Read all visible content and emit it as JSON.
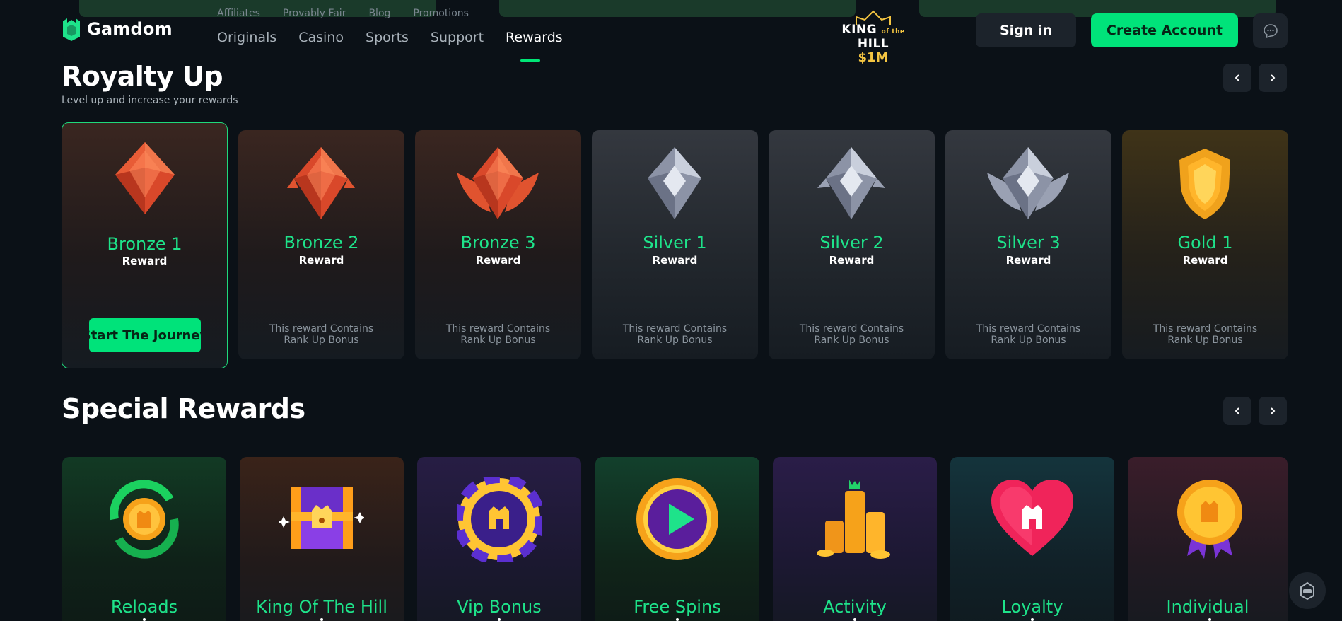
{
  "header": {
    "logo_text": "Gamdom",
    "sub_nav": [
      "Affiliates",
      "Provably Fair",
      "Blog",
      "Promotions"
    ],
    "main_nav": [
      "Originals",
      "Casino",
      "Sports",
      "Support",
      "Rewards"
    ],
    "active_nav": "Rewards",
    "promo": {
      "title_left": "KING",
      "title_small": "of the",
      "title_right": "HILL",
      "amount": "$1M"
    },
    "signin_label": "Sign in",
    "create_label": "Create Account",
    "chat_icon": "chat-bubble-icon"
  },
  "royalty": {
    "title": "Royalty Up",
    "subtitle": "Level up and increase your rewards",
    "ranks": [
      {
        "name": "Bronze 1",
        "reward": "Reward",
        "action": "Start The Journey",
        "tier": "bronze",
        "icon": "bronze-1-icon"
      },
      {
        "name": "Bronze 2",
        "reward": "Reward",
        "desc_1": "This reward Contains",
        "desc_2": "Rank Up Bonus",
        "tier": "bronze",
        "icon": "bronze-2-icon"
      },
      {
        "name": "Bronze 3",
        "reward": "Reward",
        "desc_1": "This reward Contains",
        "desc_2": "Rank Up Bonus",
        "tier": "bronze",
        "icon": "bronze-3-icon"
      },
      {
        "name": "Silver 1",
        "reward": "Reward",
        "desc_1": "This reward Contains",
        "desc_2": "Rank Up Bonus",
        "tier": "silver",
        "icon": "silver-1-icon"
      },
      {
        "name": "Silver 2",
        "reward": "Reward",
        "desc_1": "This reward Contains",
        "desc_2": "Rank Up Bonus",
        "tier": "silver",
        "icon": "silver-2-icon"
      },
      {
        "name": "Silver 3",
        "reward": "Reward",
        "desc_1": "This reward Contains",
        "desc_2": "Rank Up Bonus",
        "tier": "silver",
        "icon": "silver-3-icon"
      },
      {
        "name": "Gold 1",
        "reward": "Reward",
        "desc_1": "This reward Contains",
        "desc_2": "Rank Up Bonus",
        "tier": "gold",
        "icon": "gold-1-icon"
      }
    ]
  },
  "special": {
    "title": "Special Rewards",
    "items": [
      {
        "name": "Reloads",
        "icon": "reload-coin-icon"
      },
      {
        "name": "King Of The Hill",
        "icon": "treasure-chest-icon"
      },
      {
        "name": "Vip Bonus",
        "icon": "vip-chip-icon"
      },
      {
        "name": "Free Spins",
        "icon": "play-coin-icon"
      },
      {
        "name": "Activity",
        "icon": "coin-stacks-icon"
      },
      {
        "name": "Loyalty",
        "icon": "heart-icon"
      },
      {
        "name": "Individual",
        "icon": "medal-icon"
      }
    ]
  },
  "colors": {
    "accent": "#00e37a",
    "rank_name": "#1ee38a",
    "background": "#0b1117",
    "button_dark": "#1c232b"
  }
}
